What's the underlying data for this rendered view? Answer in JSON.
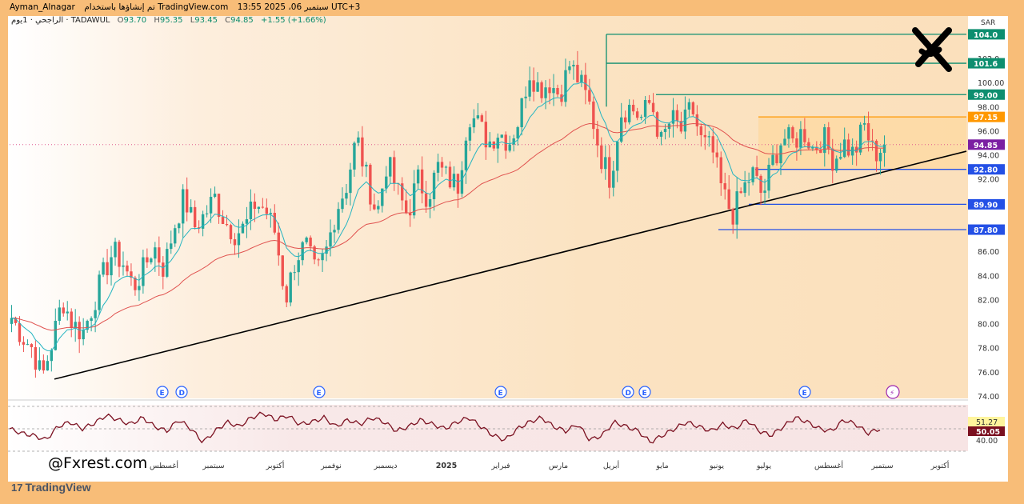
{
  "header": {
    "author": "Ayman_Alnagar",
    "published_text": "تم إنشاؤها باستخدام TradingView.com",
    "timestamp": "سبتمبر 06، 2025 13:55 UTC+3"
  },
  "legend": {
    "symbol": "الراجحي · 1يوم · TADAWUL",
    "open_label": "O",
    "open": "93.70",
    "high_label": "H",
    "high": "95.35",
    "low_label": "L",
    "low": "93.45",
    "close_label": "C",
    "close": "94.85",
    "change": "+1.55 (+1.66%)"
  },
  "watermark": "@Fxrest.com",
  "brand": "TradingView",
  "colors": {
    "up": "#26a69a",
    "down": "#ef5350",
    "ema_fast": "#26b5c2",
    "ema_slow": "#e0524f",
    "trendline": "#000000",
    "level_teal": "#0d8e6f",
    "level_blue": "#2450e6",
    "range_orange": "#ff9800",
    "rsi": "#7b1020",
    "price_line": "#e05a8f"
  },
  "chart_data": {
    "type": "candlestick",
    "currency": "SAR",
    "ylim": [
      74,
      105
    ],
    "yticks": [
      "102.0",
      "100.00",
      "98.00",
      "96.00",
      "94.00",
      "92.00",
      "90.00",
      "88.00",
      "86.00",
      "84.00",
      "82.00",
      "80.00",
      "78.00",
      "76.00",
      "74.00"
    ],
    "xlabels": [
      "أغسطس",
      "سبتمبر",
      "أكتوبر",
      "نوفمبر",
      "ديسمبر",
      "2025",
      "فبراير",
      "مارس",
      "أبريل",
      "مايو",
      "يونيو",
      "يوليو",
      "أغسطس",
      "سبتمبر",
      "أكتوبر"
    ],
    "price_levels": [
      {
        "label": "104.0",
        "value": 104.0,
        "color": "#0d8e6f"
      },
      {
        "label": "101.6",
        "value": 101.6,
        "color": "#0d8e6f"
      },
      {
        "label": "99.00",
        "value": 99.0,
        "color": "#0d8e6f"
      },
      {
        "label": "97.15",
        "value": 97.15,
        "color": "#ff9800"
      },
      {
        "label": "94.85",
        "value": 94.85,
        "color": "#7b1fa2"
      },
      {
        "label": "92.80",
        "value": 92.8,
        "color": "#2450e6"
      },
      {
        "label": "89.90",
        "value": 89.9,
        "color": "#2450e6"
      },
      {
        "label": "87.80",
        "value": 87.8,
        "color": "#2450e6"
      }
    ],
    "range_box": {
      "top": 97.15,
      "bottom": 92.8
    },
    "trendline": [
      {
        "date": "2024-07",
        "price": 75.4
      },
      {
        "date": "2025-09",
        "price": 94.3
      }
    ],
    "price_path": [
      80.5,
      79.0,
      78.0,
      75.5,
      78.5,
      82.0,
      80.0,
      79.2,
      81.5,
      84.0,
      86.0,
      85.0,
      83.0,
      84.5,
      86.5,
      84.5,
      88.0,
      90.5,
      88.0,
      89.0,
      90.5,
      88.5,
      87.5,
      88.0,
      90.0,
      89.5,
      87.5,
      82.0,
      85.5,
      86.5,
      84.0,
      86.0,
      89.5,
      91.5,
      95.5,
      92.0,
      89.0,
      93.5,
      91.0,
      89.0,
      92.0,
      90.5,
      93.0,
      92.0,
      91.5,
      97.5,
      96.5,
      95.0,
      96.0,
      95.0,
      97.0,
      101.0,
      99.5,
      100.0,
      99.0,
      101.5,
      100.0,
      98.0,
      94.0,
      92.0,
      97.5,
      98.0,
      97.0,
      98.5,
      95.0,
      97.0,
      96.0,
      98.0,
      95.0,
      94.5,
      91.0,
      89.0,
      91.0,
      92.5,
      90.5,
      93.5,
      95.5,
      95.0,
      96.0,
      94.5,
      95.5,
      93.5,
      95.0,
      94.0,
      96.5,
      94.0,
      94.85
    ],
    "events": [
      "E",
      "D",
      "E",
      "E",
      "D",
      "E",
      "E"
    ],
    "rsi": {
      "levels": [
        "51.27",
        "50.05",
        "40.00"
      ],
      "path": [
        50.0,
        46.0,
        44.0,
        40.0,
        52.0,
        56.0,
        50.0,
        55.0,
        62.0,
        58.0,
        54.0,
        60.0,
        52.0,
        48.0,
        58.0,
        50.0,
        38.0,
        48.0,
        56.0,
        52.0,
        60.0,
        64.0,
        58.0,
        62.0,
        54.0,
        56.0,
        60.0,
        52.0,
        58.0,
        54.0,
        60.0,
        56.0,
        48.0,
        52.0,
        58.0,
        54.0,
        50.0,
        56.0,
        60.0,
        52.0,
        44.0,
        40.0,
        50.0,
        56.0,
        60.0,
        52.0,
        48.0,
        54.0,
        40.0,
        44.0,
        56.0,
        52.0,
        48.0,
        38.0,
        44.0,
        50.0,
        56.0,
        52.0,
        48.0,
        54.0,
        50.0,
        58.0,
        48.0,
        44.0,
        52.0,
        60.0,
        56.0,
        50.0,
        48.0,
        58.0,
        54.0,
        46.0,
        50.05
      ]
    }
  }
}
